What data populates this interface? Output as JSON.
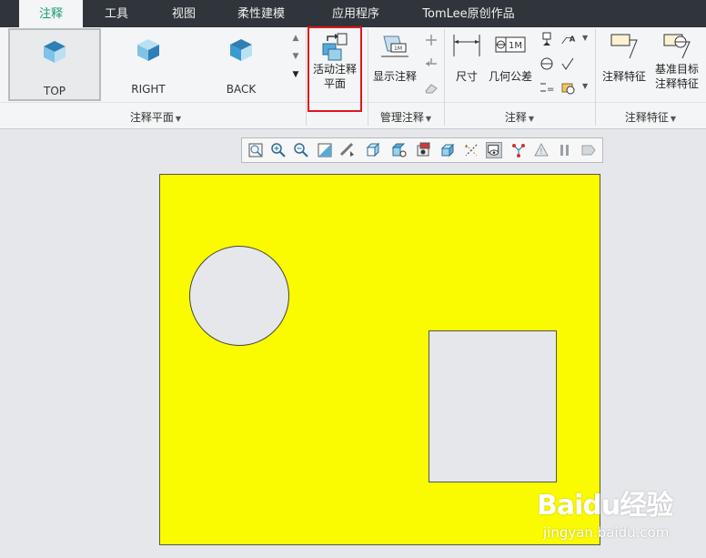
{
  "tabs": [
    {
      "label": "注释",
      "active": true
    },
    {
      "label": "工具"
    },
    {
      "label": "视图"
    },
    {
      "label": "柔性建模"
    },
    {
      "label": "应用程序"
    },
    {
      "label": "TomLee原创作品"
    }
  ],
  "ribbon": {
    "views": [
      {
        "label": "TOP",
        "selected": true
      },
      {
        "label": "RIGHT"
      },
      {
        "label": "BACK"
      }
    ],
    "activate_annotation_plane": {
      "line1": "活动注释",
      "line2": "平面"
    },
    "show_annotations": "显示注释",
    "dimension": "尺寸",
    "geometric_tolerance": "几何公差",
    "annotation_feature": "注释特征",
    "datum_target": {
      "line1": "基准目标",
      "line2": "注释特征"
    },
    "groups": {
      "annotation_plane": "注释平面",
      "manage_annotations": "管理注释",
      "annotations": "注释",
      "annotation_features": "注释特征"
    },
    "gtol_symbol": "1M"
  },
  "watermark": {
    "logo": "Baidu经验",
    "url": "jingyan.baidu.com"
  },
  "colors": {
    "model_fill": "#fbfb00",
    "tab_active_text": "#1a9b6e",
    "highlight": "#e0161d"
  }
}
